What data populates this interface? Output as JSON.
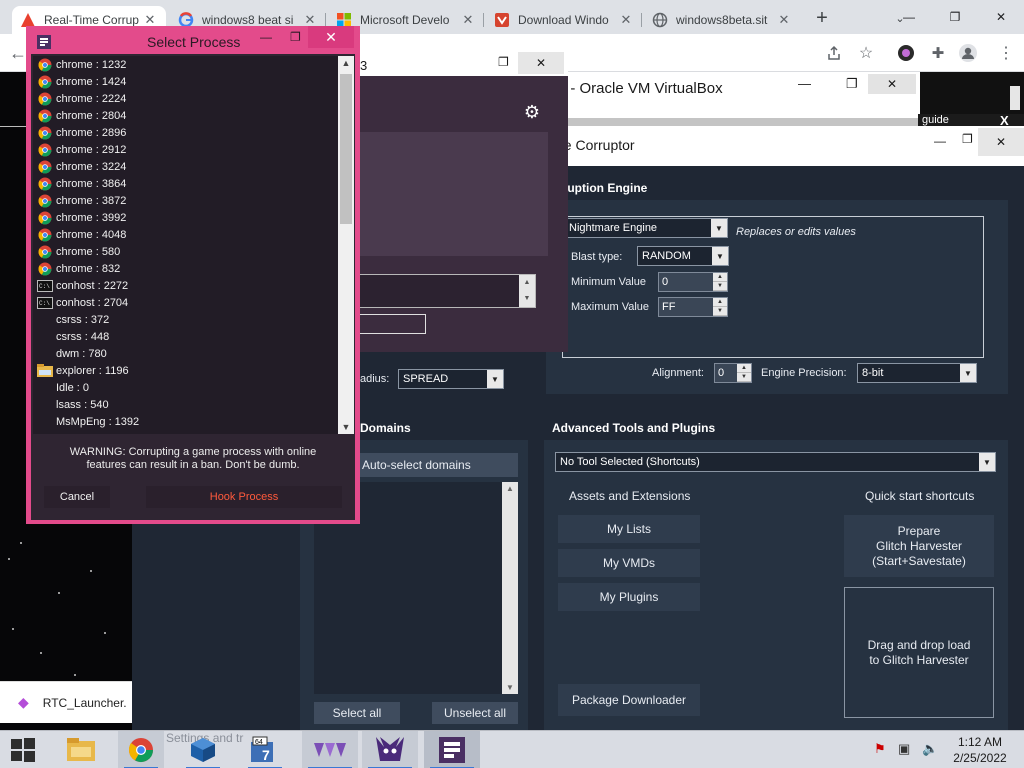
{
  "browser": {
    "tabs": [
      {
        "title": "Real-Time Corrup",
        "icon": "triangle-warning-icon",
        "color": "#e8402f"
      },
      {
        "title": "windows8 beat si",
        "icon": "google-icon"
      },
      {
        "title": "Microsoft Develo",
        "icon": "microsoft-icon"
      },
      {
        "title": "Download Windo",
        "icon": "shield-logo-icon"
      },
      {
        "title": "windows8beta.sit",
        "icon": "globe-icon"
      }
    ],
    "new_tab": "+"
  },
  "vbox": {
    "title": "] - Oracle VM VirtualBox",
    "guide": "guide",
    "close": "X"
  },
  "rtc_small": {
    "title_fragment": "3"
  },
  "rtc": {
    "title": "ne Corruptor",
    "engine_header": "rruption Engine",
    "engine": {
      "selected": "Nightmare Engine",
      "description": "Replaces or edits values",
      "blast_type_label": "Blast type:",
      "blast_type_value": "RANDOM",
      "min_label": "Minimum Value",
      "min_value": "0",
      "max_label": "Maximum Value",
      "max_value": "FF",
      "alignment_label": "Alignment:",
      "alignment_value": "0",
      "precision_label": "Engine Precision:",
      "precision_value": "8-bit"
    },
    "radius_label": "adius:",
    "radius_value": "SPREAD",
    "domains_header": "Domains",
    "auto_select": "Auto-select domains",
    "select_all": "Select all",
    "unselect_all": "Unselect all",
    "advanced_header": "Advanced Tools and Plugins",
    "tool_selected": "No Tool Selected (Shortcuts)",
    "assets_header": "Assets and Extensions",
    "quick_header": "Quick start shortcuts",
    "my_lists": "My Lists",
    "my_vmds": "My VMDs",
    "my_plugins": "My Plugins",
    "package_downloader": "Package Downloader",
    "prepare": "Prepare\nGlitch Harvester\n(Start+Savestate)",
    "drag_drop": "Drag and drop load\nto Glitch Harvester"
  },
  "dialog": {
    "title": "Select Process",
    "processes": [
      {
        "name": "chrome : 1232",
        "icon": "chrome-icon"
      },
      {
        "name": "chrome : 1424",
        "icon": "chrome-icon"
      },
      {
        "name": "chrome : 2224",
        "icon": "chrome-icon"
      },
      {
        "name": "chrome : 2804",
        "icon": "chrome-icon"
      },
      {
        "name": "chrome : 2896",
        "icon": "chrome-icon"
      },
      {
        "name": "chrome : 2912",
        "icon": "chrome-icon"
      },
      {
        "name": "chrome : 3224",
        "icon": "chrome-icon"
      },
      {
        "name": "chrome : 3864",
        "icon": "chrome-icon"
      },
      {
        "name": "chrome : 3872",
        "icon": "chrome-icon"
      },
      {
        "name": "chrome : 3992",
        "icon": "chrome-icon"
      },
      {
        "name": "chrome : 4048",
        "icon": "chrome-icon"
      },
      {
        "name": "chrome : 580",
        "icon": "chrome-icon"
      },
      {
        "name": "chrome : 832",
        "icon": "chrome-icon"
      },
      {
        "name": "conhost : 2272",
        "icon": "console-icon"
      },
      {
        "name": "conhost : 2704",
        "icon": "console-icon"
      },
      {
        "name": "csrss : 372",
        "icon": ""
      },
      {
        "name": "csrss : 448",
        "icon": ""
      },
      {
        "name": "dwm : 780",
        "icon": ""
      },
      {
        "name": "explorer : 1196",
        "icon": "folder-icon"
      },
      {
        "name": "Idle : 0",
        "icon": ""
      },
      {
        "name": "lsass : 540",
        "icon": ""
      },
      {
        "name": "MsMpEng : 1392",
        "icon": ""
      }
    ],
    "warning": "WARNING: Corrupting a game process with online\nfeatures can result in a ban.  Don't be dumb.",
    "cancel": "Cancel",
    "hook": "Hook Process"
  },
  "desktop": {
    "launcher": "RTC_Launcher."
  },
  "taskbar": {
    "ghost_text": "Settings and tr",
    "time": "1:12 AM",
    "date": "2/25/2022"
  }
}
